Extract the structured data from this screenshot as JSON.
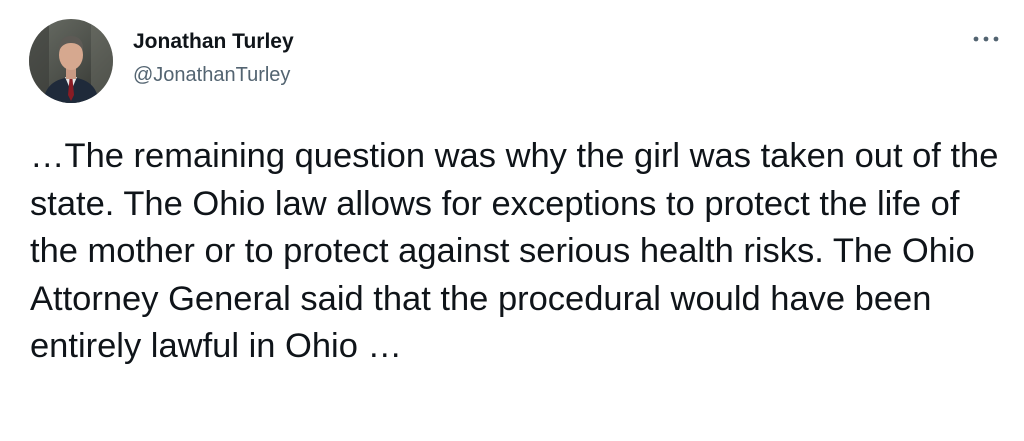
{
  "author": {
    "name": "Jonathan Turley",
    "handle": "@JonathanTurley",
    "avatar_icon": "person-photo"
  },
  "more_icon": "more-options-icon",
  "tweet": {
    "text": "…The remaining question was why the girl was taken out of the state. The Ohio law allows for exceptions to protect the life of the mother or to protect against serious health risks. The Ohio Attorney General said that the procedural would have been entirely lawful in Ohio …"
  },
  "colors": {
    "text": "#0f1419",
    "secondary": "#536471"
  }
}
